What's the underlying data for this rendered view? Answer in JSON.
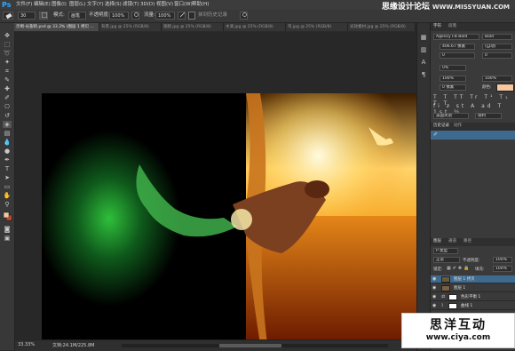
{
  "menubar": {
    "logo": "Ps",
    "items": [
      "文件(F)",
      "编辑(E)",
      "图像(I)",
      "图层(L)",
      "文字(Y)",
      "选择(S)",
      "滤镜(T)",
      "3D(D)",
      "视图(V)",
      "窗口(W)",
      "帮助(H)"
    ],
    "watermark_site": "思缘设计论坛",
    "watermark_url": "WWW.MISSYUAN.COM"
  },
  "options": {
    "size": "30",
    "mode_label": "模式:",
    "mode_value": "画笔",
    "opacity_label": "不透明度:",
    "opacity_value": "100%",
    "flow_label": "流量:",
    "flow_value": "100%",
    "erase_history": "抹到历史记录"
  },
  "tabs": [
    {
      "label": "示例-长翅的.psd @ 33.3% (图层 1 拷贝 ...",
      "active": true
    },
    {
      "label": "背景.jpg @ 25% (RGB/8)",
      "active": false
    },
    {
      "label": "翅膀.jpg @ 25% (RGB/8)",
      "active": false
    },
    {
      "label": "水滴.jpg @ 25% (RGB/8)",
      "active": false
    },
    {
      "label": "鸟.jpg @ 25% (RGB/8)",
      "active": false
    },
    {
      "label": "光效素材.jpg @ 25% (RGB/8)",
      "active": false
    }
  ],
  "statusbar": {
    "zoom": "33.33%",
    "doc": "文档:24.1M/225.8M"
  },
  "character_panel": {
    "tabs": [
      "字符",
      "段落"
    ],
    "font_family": "Agency FB Bold",
    "font_style": "Bold",
    "size": "406.67 像素",
    "leading": "(自动)",
    "kerning": "0",
    "tracking": "0%",
    "scale_v": "100%",
    "scale_h": "100%",
    "baseline": "0 像素",
    "color_label": "颜色:",
    "language": "美国英语",
    "aa": "锐利"
  },
  "history_panel": {
    "tabs": [
      "历史记录",
      "动作"
    ]
  },
  "layers_panel": {
    "tabs": [
      "图层",
      "通道",
      "路径"
    ],
    "kind_label": "P 类型",
    "blend_mode": "正常",
    "opacity_label": "不透明度:",
    "opacity_value": "100%",
    "lock_label": "锁定:",
    "fill_label": "填充:",
    "fill_value": "100%",
    "layers": [
      {
        "name": "图层 1 拷贝",
        "selected": true,
        "thumb": "#6a5a3a"
      },
      {
        "name": "图层 1",
        "selected": false,
        "thumb": "#7a6040"
      },
      {
        "name": "色彩平衡 1",
        "selected": false,
        "thumb": "#ffffff"
      },
      {
        "name": "曲线 1",
        "selected": false,
        "thumb": "#ffffff"
      }
    ]
  },
  "bottom_watermark": {
    "title": "思洋互动",
    "url": "www.ciya.com"
  },
  "colors": {
    "foreground": "#e8c9a8",
    "background": "#d84a2a",
    "text_color_swatch": "#f7c7a0"
  }
}
